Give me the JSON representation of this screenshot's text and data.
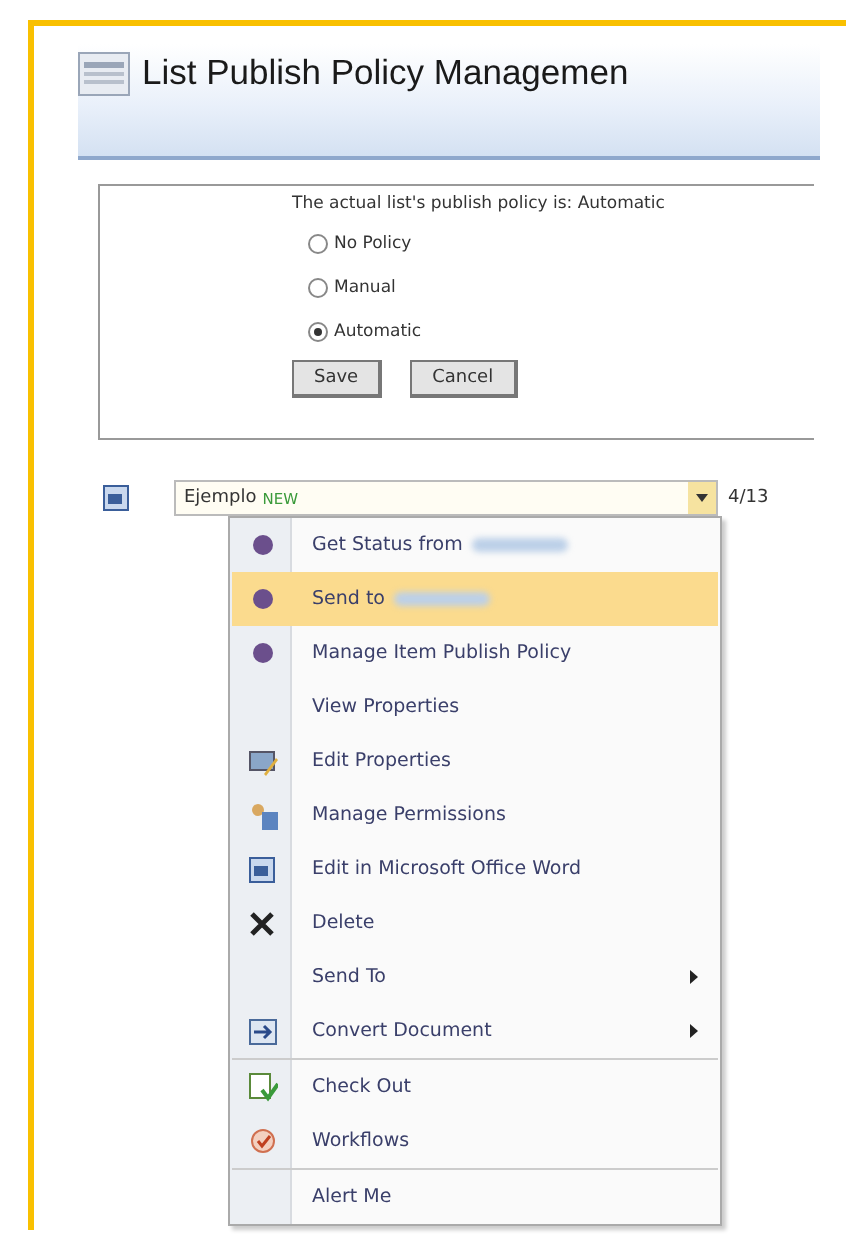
{
  "title": "List Publish Policy Managemen",
  "policy": {
    "message": "The actual list's publish policy is: Automatic",
    "options": [
      {
        "label": "No Policy",
        "selected": false
      },
      {
        "label": "Manual",
        "selected": false
      },
      {
        "label": "Automatic",
        "selected": true
      }
    ],
    "buttons": [
      "Save",
      "Cancel"
    ]
  },
  "item": {
    "name": "Ejemplo",
    "badge": "NEW",
    "date": "4/13"
  },
  "menu": [
    {
      "label": "Get Status from",
      "redacted": true,
      "selected": false,
      "submenu": false,
      "separator_before": false
    },
    {
      "label": "Send to",
      "redacted": true,
      "selected": true,
      "submenu": false,
      "separator_before": false
    },
    {
      "label": "Manage Item Publish Policy",
      "redacted": false,
      "selected": false,
      "submenu": false,
      "separator_before": false
    },
    {
      "label": "View Properties",
      "redacted": false,
      "selected": false,
      "submenu": false,
      "separator_before": false
    },
    {
      "label": "Edit Properties",
      "redacted": false,
      "selected": false,
      "submenu": false,
      "separator_before": false
    },
    {
      "label": "Manage Permissions",
      "redacted": false,
      "selected": false,
      "submenu": false,
      "separator_before": false
    },
    {
      "label": "Edit in Microsoft Office Word",
      "redacted": false,
      "selected": false,
      "submenu": false,
      "separator_before": false
    },
    {
      "label": "Delete",
      "redacted": false,
      "selected": false,
      "submenu": false,
      "separator_before": false
    },
    {
      "label": "Send To",
      "redacted": false,
      "selected": false,
      "submenu": true,
      "separator_before": false
    },
    {
      "label": "Convert Document",
      "redacted": false,
      "selected": false,
      "submenu": true,
      "separator_before": false
    },
    {
      "label": "Check Out",
      "redacted": false,
      "selected": false,
      "submenu": false,
      "separator_before": true
    },
    {
      "label": "Workflows",
      "redacted": false,
      "selected": false,
      "submenu": false,
      "separator_before": false
    },
    {
      "label": "Alert Me",
      "redacted": false,
      "selected": false,
      "submenu": false,
      "separator_before": true
    }
  ]
}
